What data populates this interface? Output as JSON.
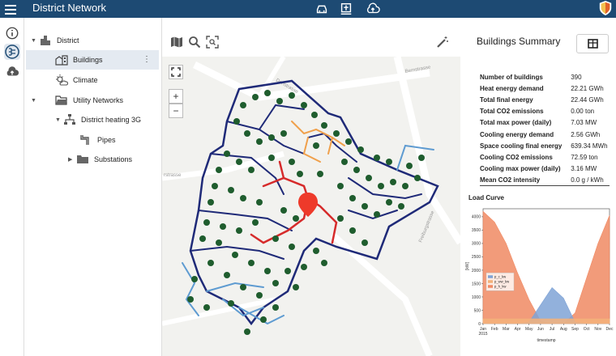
{
  "header": {
    "title": "District Network",
    "icons": [
      "menu-icon",
      "car-icon",
      "monument-icon",
      "cloud-upload-icon"
    ]
  },
  "rail": {
    "icons": [
      "info-icon",
      "network-icon",
      "cloud-upload-icon"
    ]
  },
  "tree": {
    "items": [
      {
        "label": "District",
        "icon": "city-icon",
        "expanded": true
      },
      {
        "label": "Buildings",
        "icon": "buildings-icon",
        "selected": true
      },
      {
        "label": "Climate",
        "icon": "climate-icon"
      },
      {
        "label": "Utility Networks",
        "icon": "folder-open-icon",
        "expanded": true
      },
      {
        "label": "District heating 3G",
        "icon": "network-tree-icon",
        "expanded": true
      },
      {
        "label": "Pipes",
        "icon": "pipes-icon"
      },
      {
        "label": "Substations",
        "icon": "folder-icon",
        "expanded": false
      }
    ]
  },
  "map": {
    "toolbar": [
      "map-icon",
      "search-icon",
      "focus-icon",
      "magic-wand-icon"
    ],
    "controls": {
      "zoom_in": "+",
      "zoom_out": "−"
    },
    "street_labels": [
      "Bernstrasse",
      "Freiburgstrasse",
      "Dorfstrasse",
      "rstrasse"
    ],
    "colors": {
      "dark_pipe": "#1f2a78",
      "light_pipe": "#5e9bd1",
      "red_pipe": "#d62b2b",
      "orange_pipe": "#f0a04b",
      "building": "#1f5d2e",
      "marker": "#ee3a2a"
    }
  },
  "summary": {
    "title": "Buildings Summary",
    "rows": [
      {
        "label": "Number of buildings",
        "value": "390"
      },
      {
        "label": "Heat energy demand",
        "value": "22.21 GWh"
      },
      {
        "label": "Total final energy",
        "value": "22.44 GWh"
      },
      {
        "label": "Total CO2 emissions",
        "value": "0.00 ton"
      },
      {
        "label": "Total max power (daily)",
        "value": "7.03 MW"
      },
      {
        "label": "Cooling energy demand",
        "value": "2.56 GWh"
      },
      {
        "label": "Space cooling final energy",
        "value": "639.34 MWh"
      },
      {
        "label": "Cooling CO2 emissions",
        "value": "72.59 ton"
      },
      {
        "label": "Cooling max power (daily)",
        "value": "3.16 MW"
      },
      {
        "label": "Mean CO2 intensity",
        "value": "0.0 g / kWh"
      }
    ],
    "load_curve_title": "Load Curve"
  },
  "chart_data": {
    "type": "area",
    "xlabel": "timestamp",
    "ylabel": "[kW]",
    "categories": [
      "Jan\n2015",
      "Feb",
      "Mar",
      "Apr",
      "May",
      "Jun",
      "Jul",
      "Aug",
      "Sep",
      "Oct",
      "Nov",
      "Dec"
    ],
    "ylim": [
      0,
      4300
    ],
    "yticks": [
      0,
      500,
      1000,
      1500,
      2000,
      2500,
      3000,
      3500,
      4000
    ],
    "legend_placement": "center-left",
    "series": [
      {
        "name": "p_c_kw",
        "color": "#7fa3d6",
        "values": [
          0,
          0,
          0,
          0,
          50,
          700,
          1350,
          950,
          50,
          0,
          0,
          0
        ]
      },
      {
        "name": "p_ww_kw",
        "color": "#f4b27a",
        "values": [
          180,
          180,
          180,
          180,
          180,
          180,
          180,
          180,
          180,
          180,
          180,
          180
        ]
      },
      {
        "name": "p_h_kw",
        "color": "#f08a63",
        "values": [
          4200,
          3800,
          3000,
          1900,
          900,
          100,
          0,
          0,
          400,
          1700,
          3000,
          4050
        ]
      }
    ]
  }
}
